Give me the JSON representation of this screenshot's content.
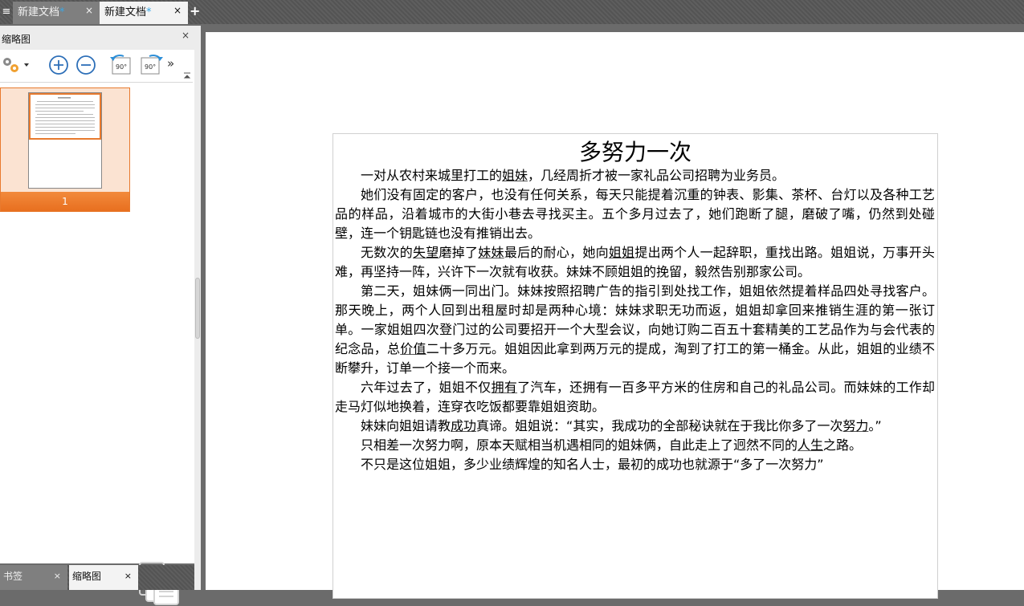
{
  "tabs": [
    {
      "label": "新建文档",
      "modified": "*",
      "close": "×",
      "active": false
    },
    {
      "label": "新建文档",
      "modified": "*",
      "close": "×",
      "active": true
    }
  ],
  "menu_icon": "≡",
  "new_tab_icon": "+",
  "panel": {
    "title": "缩略图",
    "close": "×",
    "toolbar_icons": [
      "settings-icon",
      "zoom-in-icon",
      "zoom-out-icon",
      "rotate-left-icon",
      "rotate-right-icon",
      "more-icon"
    ],
    "rotate_label": "90°",
    "more_glyph": "»",
    "thumbnail": {
      "page_number": "1",
      "selected": true
    }
  },
  "bottom_tabs": [
    {
      "label": "书签",
      "close": "×",
      "active": false
    },
    {
      "label": "缩略图",
      "close": "×",
      "active": true
    }
  ],
  "document": {
    "title": "多努力一次",
    "paragraphs": [
      [
        {
          "t": "一对从农村来城里打工的"
        },
        {
          "t": "姐妹",
          "u": true
        },
        {
          "t": "，几经周折才被一家礼品公司招聘为业务员。"
        }
      ],
      [
        {
          "t": "她们没有固定的客户，也没有任何关系，每天只能提着沉重的钟表、影集、茶杯、台灯以及各种工艺品的样品，沿着城市的大街小巷去寻找买主。五个多月过去了，她们跑断了腿，磨破了嘴，仍然到处碰壁，连一个钥匙链也没有推销出去。"
        }
      ],
      [
        {
          "t": "无数次的"
        },
        {
          "t": "失望",
          "u": true
        },
        {
          "t": "磨掉了"
        },
        {
          "t": "妹妹",
          "u": true
        },
        {
          "t": "最后的耐心，她向"
        },
        {
          "t": "姐姐",
          "u": true
        },
        {
          "t": "提出两个人一起辞职，重找出路。姐姐说，万事开头难，再坚持一阵，兴许下一次就有收获。妹妹不顾姐姐的挽留，毅然告别那家公司。"
        }
      ],
      [
        {
          "t": "第二天，姐妹俩一同出门。妹妹按照招聘广告的指引到处找工作，姐姐依然提着样品四处寻找客户。那天晚上，两个人回到出租屋时却是两种心境：妹妹求职无功而返，姐姐却拿回来推销生涯的第一张订单。一家姐姐四次登门过的公司要招开一个大型会议，向她订购二百五十套精美的工艺品作为与会代表的纪念品，总"
        },
        {
          "t": "价值",
          "u": true
        },
        {
          "t": "二十多万元。姐姐因此拿到两万元的提成，淘到了打工的第一桶金。从此，姐姐的业绩不断攀升，订单一个接一个而来。"
        }
      ],
      [
        {
          "t": "六年过去了，姐姐不仅"
        },
        {
          "t": "拥有",
          "u": true
        },
        {
          "t": "了汽车，还拥有一百多平方米的住房和自己的礼品公司。而妹妹的工作却走马灯似地换着，连穿衣吃饭都要靠姐姐资助。"
        }
      ],
      [
        {
          "t": "妹妹向姐姐请教"
        },
        {
          "t": "成功",
          "u": true
        },
        {
          "t": "真谛。姐姐说：“其实，我成功的全部秘诀就在于我比你多了一次"
        },
        {
          "t": "努力",
          "u": true
        },
        {
          "t": "。”"
        }
      ],
      [
        {
          "t": "只相差一次努力啊，原本天赋相当机遇相同的姐妹俩，自此走上了迥然不同的"
        },
        {
          "t": "人生",
          "u": true
        },
        {
          "t": "之路。"
        }
      ],
      [
        {
          "t": "不只是这位姐姐，多少业绩辉煌的知名人士，最初的成功也就源于“多了一次努力”"
        }
      ]
    ]
  },
  "colors": {
    "accent": "#e87a2e",
    "tab_modified": "#3aa7e6",
    "chrome_dark": "#5a5a5a",
    "panel_bg": "#ffffff"
  }
}
